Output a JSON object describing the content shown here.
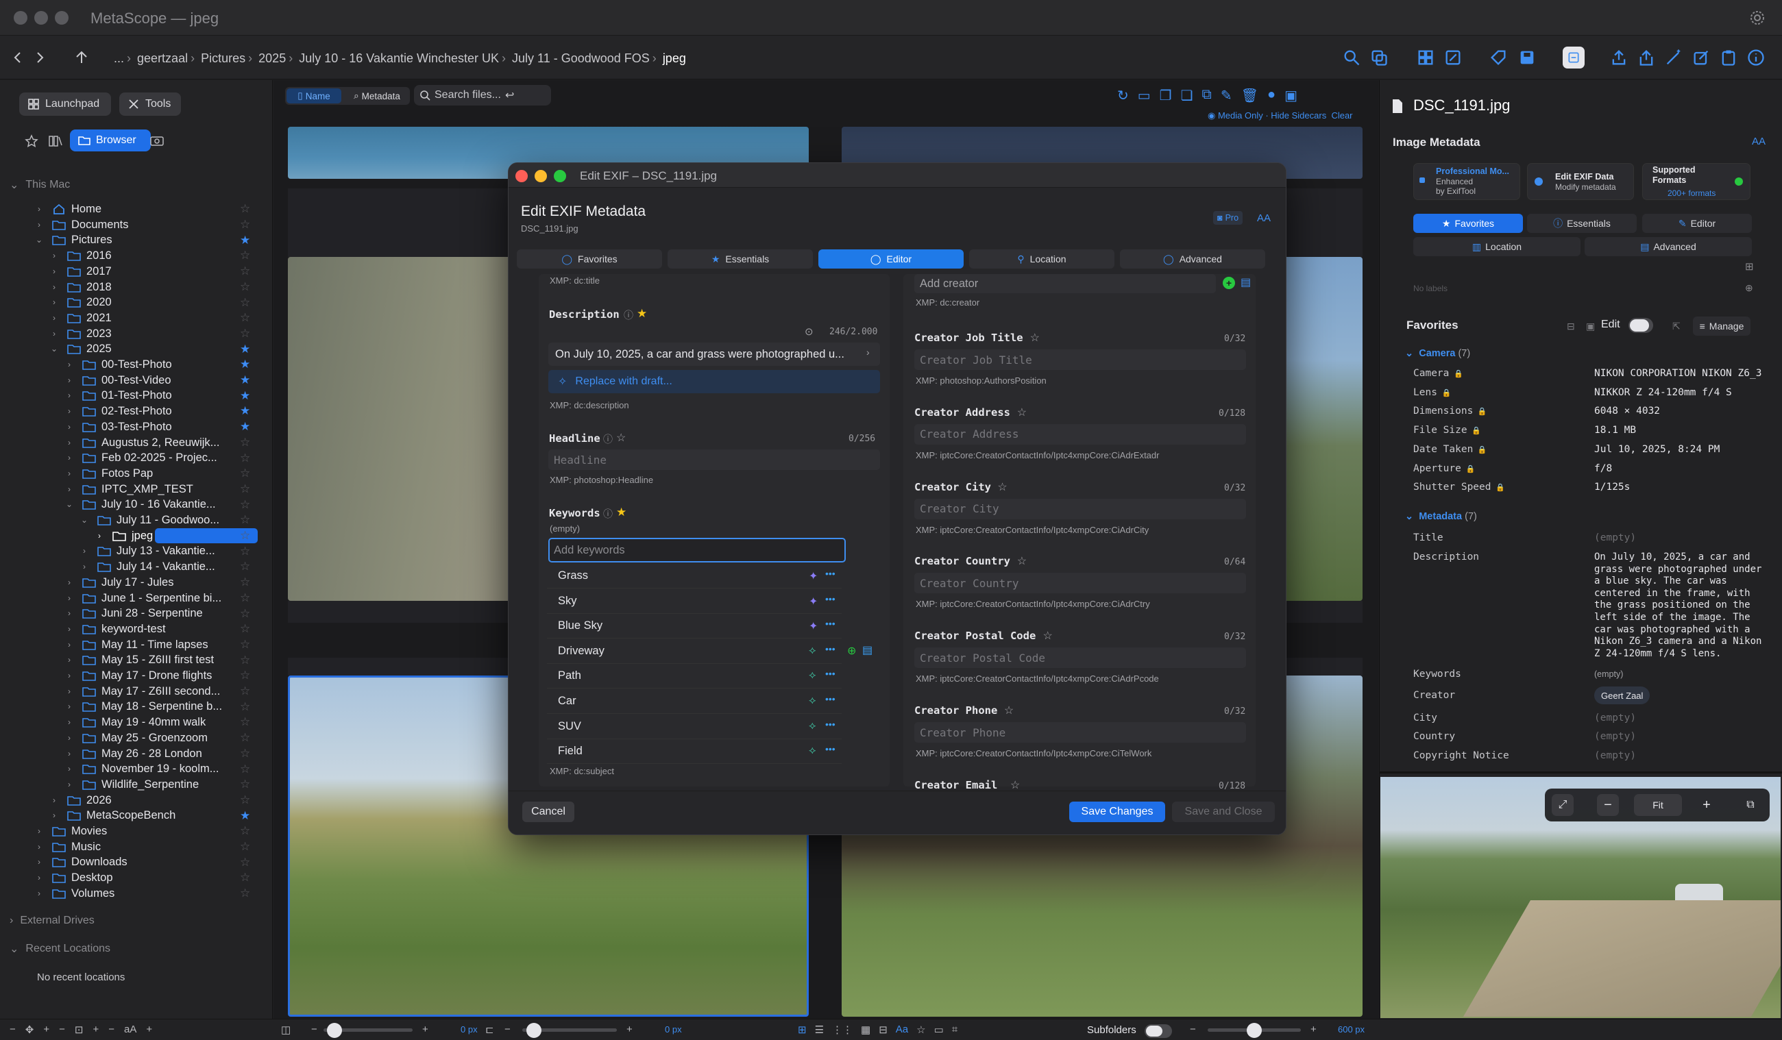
{
  "app": {
    "title": "MetaScope — jpeg"
  },
  "breadcrumb": [
    "...",
    "geertzaal",
    "Pictures",
    "2025",
    "July 10 - 16 Vakantie Winchester UK",
    "July 11 - Goodwood FOS",
    "jpeg"
  ],
  "sidebar": {
    "launchpad": "Launchpad",
    "tools": "Tools",
    "browser": "Browser",
    "this_mac": "This Mac",
    "tree": [
      {
        "label": "Home",
        "level": 1,
        "chev": ">",
        "star": false,
        "icon": "home"
      },
      {
        "label": "Documents",
        "level": 1,
        "chev": ">",
        "star": false
      },
      {
        "label": "Pictures",
        "level": 1,
        "chev": "v",
        "star": true
      },
      {
        "label": "2016",
        "level": 2,
        "chev": ">",
        "star": false
      },
      {
        "label": "2017",
        "level": 2,
        "chev": ">",
        "star": false
      },
      {
        "label": "2018",
        "level": 2,
        "chev": ">",
        "star": false
      },
      {
        "label": "2020",
        "level": 2,
        "chev": ">",
        "star": false
      },
      {
        "label": "2021",
        "level": 2,
        "chev": ">",
        "star": false
      },
      {
        "label": "2023",
        "level": 2,
        "chev": ">",
        "star": false
      },
      {
        "label": "2025",
        "level": 2,
        "chev": "v",
        "star": true
      },
      {
        "label": "00-Test-Photo",
        "level": 3,
        "chev": ">",
        "star": true
      },
      {
        "label": "00-Test-Video",
        "level": 3,
        "chev": ">",
        "star": true
      },
      {
        "label": "01-Test-Photo",
        "level": 3,
        "chev": ">",
        "star": true
      },
      {
        "label": "02-Test-Photo",
        "level": 3,
        "chev": ">",
        "star": true
      },
      {
        "label": "03-Test-Photo",
        "level": 3,
        "chev": ">",
        "star": true
      },
      {
        "label": "Augustus 2, Reeuwijk...",
        "level": 3,
        "chev": ">",
        "star": false
      },
      {
        "label": "Feb 02-2025 - Projec...",
        "level": 3,
        "chev": ">",
        "star": false
      },
      {
        "label": "Fotos Pap",
        "level": 3,
        "chev": ">",
        "star": false
      },
      {
        "label": "IPTC_XMP_TEST",
        "level": 3,
        "chev": ">",
        "star": false
      },
      {
        "label": "July 10 - 16 Vakantie...",
        "level": 3,
        "chev": "v",
        "star": false
      },
      {
        "label": "July 11 - Goodwoo...",
        "level": 4,
        "chev": "v",
        "star": false
      },
      {
        "label": "jpeg",
        "level": 5,
        "chev": ">",
        "star": false,
        "selected": true
      },
      {
        "label": "July 13 - Vakantie...",
        "level": 4,
        "chev": ">",
        "star": false
      },
      {
        "label": "July 14 - Vakantie...",
        "level": 4,
        "chev": ">",
        "star": false
      },
      {
        "label": "July 17 - Jules",
        "level": 3,
        "chev": ">",
        "star": false
      },
      {
        "label": "June 1 - Serpentine bi...",
        "level": 3,
        "chev": ">",
        "star": false
      },
      {
        "label": "Juni 28 - Serpentine",
        "level": 3,
        "chev": ">",
        "star": false
      },
      {
        "label": "keyword-test",
        "level": 3,
        "chev": ">",
        "star": false
      },
      {
        "label": "May 11 - Time lapses",
        "level": 3,
        "chev": ">",
        "star": false
      },
      {
        "label": "May 15 - Z6III first test",
        "level": 3,
        "chev": ">",
        "star": false
      },
      {
        "label": "May 17 - Drone flights",
        "level": 3,
        "chev": ">",
        "star": false
      },
      {
        "label": "May 17 - Z6III second...",
        "level": 3,
        "chev": ">",
        "star": false
      },
      {
        "label": "May 18 - Serpentine b...",
        "level": 3,
        "chev": ">",
        "star": false
      },
      {
        "label": "May 19 - 40mm walk",
        "level": 3,
        "chev": ">",
        "star": false
      },
      {
        "label": "May 25 - Groenzoom",
        "level": 3,
        "chev": ">",
        "star": false
      },
      {
        "label": "May 26 - 28 London",
        "level": 3,
        "chev": ">",
        "star": false
      },
      {
        "label": "November 19 - koolm...",
        "level": 3,
        "chev": ">",
        "star": false
      },
      {
        "label": "Wildlife_Serpentine",
        "level": 3,
        "chev": ">",
        "star": false
      },
      {
        "label": "2026",
        "level": 2,
        "chev": ">",
        "star": false
      },
      {
        "label": "MetaScopeBench",
        "level": 2,
        "chev": ">",
        "star": true
      },
      {
        "label": "Movies",
        "level": 1,
        "chev": ">",
        "star": false
      },
      {
        "label": "Music",
        "level": 1,
        "chev": ">",
        "star": false
      },
      {
        "label": "Downloads",
        "level": 1,
        "chev": ">",
        "star": false
      },
      {
        "label": "Desktop",
        "level": 1,
        "chev": ">",
        "star": false
      },
      {
        "label": "Volumes",
        "level": 1,
        "chev": ">",
        "star": false
      }
    ],
    "external_drives": "External Drives",
    "recent_locations": "Recent Locations",
    "no_recent": "No recent locations"
  },
  "browser": {
    "tab_name": "Name",
    "tab_metadata": "Metadata",
    "search_placeholder": "Search files...",
    "filter_text": "Media Only · Hide Sidecars",
    "clear": "Clear"
  },
  "footer": {
    "px1": "0 px",
    "px2": "0 px",
    "subfolders": "Subfolders",
    "px3": "600 px",
    "slider1": 0.05,
    "slider2": 0.05,
    "slider3": 0.5
  },
  "modal": {
    "window_title": "Edit EXIF – DSC_1191.jpg",
    "heading": "Edit EXIF Metadata",
    "filename": "DSC_1191.jpg",
    "pro": "Pro",
    "aa": "AA",
    "tabs": [
      "Favorites",
      "Essentials",
      "Editor",
      "Location",
      "Advanced"
    ],
    "xmp_title": "XMP: dc:title",
    "description_label": "Description",
    "description_count": "246/2.000",
    "description_value": "On July 10, 2025, a car and grass were photographed u...",
    "replace_draft": "Replace with draft...",
    "xmp_description": "XMP: dc:description",
    "headline_label": "Headline",
    "headline_count": "0/256",
    "headline_placeholder": "Headline",
    "xmp_headline": "XMP: photoshop:Headline",
    "keywords_label": "Keywords",
    "keywords_empty": "(empty)",
    "keywords_placeholder": "Add keywords",
    "keywords": [
      "Grass",
      "Sky",
      "Blue Sky",
      "Driveway",
      "Path",
      "Car",
      "SUV",
      "Field"
    ],
    "xmp_subject": "XMP: dc:subject",
    "creator_placeholder": "Add creator",
    "xmp_creator": "XMP: dc:creator",
    "fields": [
      {
        "label": "Creator Job Title",
        "count": "0/32",
        "placeholder": "Creator Job Title",
        "xmp": "XMP: photoshop:AuthorsPosition"
      },
      {
        "label": "Creator Address",
        "count": "0/128",
        "placeholder": "Creator Address",
        "xmp": "XMP: iptcCore:CreatorContactInfo/Iptc4xmpCore:CiAdrExtadr"
      },
      {
        "label": "Creator City",
        "count": "0/32",
        "placeholder": "Creator City",
        "xmp": "XMP: iptcCore:CreatorContactInfo/Iptc4xmpCore:CiAdrCity"
      },
      {
        "label": "Creator Country",
        "count": "0/64",
        "placeholder": "Creator Country",
        "xmp": "XMP: iptcCore:CreatorContactInfo/Iptc4xmpCore:CiAdrCtry"
      },
      {
        "label": "Creator Postal Code",
        "count": "0/32",
        "placeholder": "Creator Postal Code",
        "xmp": "XMP: iptcCore:CreatorContactInfo/Iptc4xmpCore:CiAdrPcode"
      },
      {
        "label": "Creator Phone",
        "count": "0/32",
        "placeholder": "Creator Phone",
        "xmp": "XMP: iptcCore:CreatorContactInfo/Iptc4xmpCore:CiTelWork"
      }
    ],
    "creator_email_label": "Creator Email",
    "creator_email_count": "0/128",
    "cancel": "Cancel",
    "save_changes": "Save Changes",
    "save_close": "Save and Close"
  },
  "rpanel": {
    "filename": "DSC_1191.jpg",
    "image_metadata": "Image Metadata",
    "aa": "AA",
    "cards": [
      {
        "title": "Professional Mo...",
        "sub1": "Enhanced",
        "sub2": "by ExifTool"
      },
      {
        "title": "Edit EXIF Data",
        "sub1": "Modify metadata",
        "sub2": ""
      },
      {
        "title": "Supported Formats",
        "sub1": "200+ formats",
        "sub2": ""
      }
    ],
    "tabs": [
      "Favorites",
      "Essentials",
      "Editor",
      "Location",
      "Advanced"
    ],
    "no_labels": "No labels",
    "favorites": "Favorites",
    "edit": "Edit",
    "manage": "Manage",
    "camera_group": "Camera",
    "camera_count": "(7)",
    "camera_rows": [
      {
        "k": "Camera",
        "v": "NIKON CORPORATION NIKON Z6_3"
      },
      {
        "k": "Lens",
        "v": "NIKKOR Z 24-120mm f/4 S"
      },
      {
        "k": "Dimensions",
        "v": "6048 × 4032"
      },
      {
        "k": "File Size",
        "v": "18.1 MB"
      },
      {
        "k": "Date Taken",
        "v": "Jul 10, 2025, 8:24 PM"
      },
      {
        "k": "Aperture",
        "v": "f/8"
      },
      {
        "k": "Shutter Speed",
        "v": "1/125s"
      }
    ],
    "meta_group": "Metadata",
    "meta_count": "(7)",
    "title_k": "Title",
    "title_v": "(empty)",
    "desc_k": "Description",
    "desc_lines": [
      "On July 10, 2025, a car and",
      "grass were photographed under",
      "a blue sky. The car was",
      "centered in the frame, with",
      "the grass positioned on the",
      "left side of the image. The",
      "car was photographed with a",
      "Nikon Z6_3 camera and a Nikon",
      "Z 24-120mm f/4 S lens."
    ],
    "keywords_k": "Keywords",
    "keywords_v": "(empty)",
    "creator_k": "Creator",
    "creator_v": "Geert Zaal",
    "city_k": "City",
    "city_v": "(empty)",
    "country_k": "Country",
    "country_v": "(empty)",
    "copyright_k": "Copyright Notice",
    "copyright_v": "(empty)",
    "fit": "Fit"
  },
  "colors": {
    "accent": "#1f6fe8",
    "star": "#3d8cf5",
    "green": "#28c940",
    "red": "#ff5f57",
    "yellow": "#febc2e"
  }
}
